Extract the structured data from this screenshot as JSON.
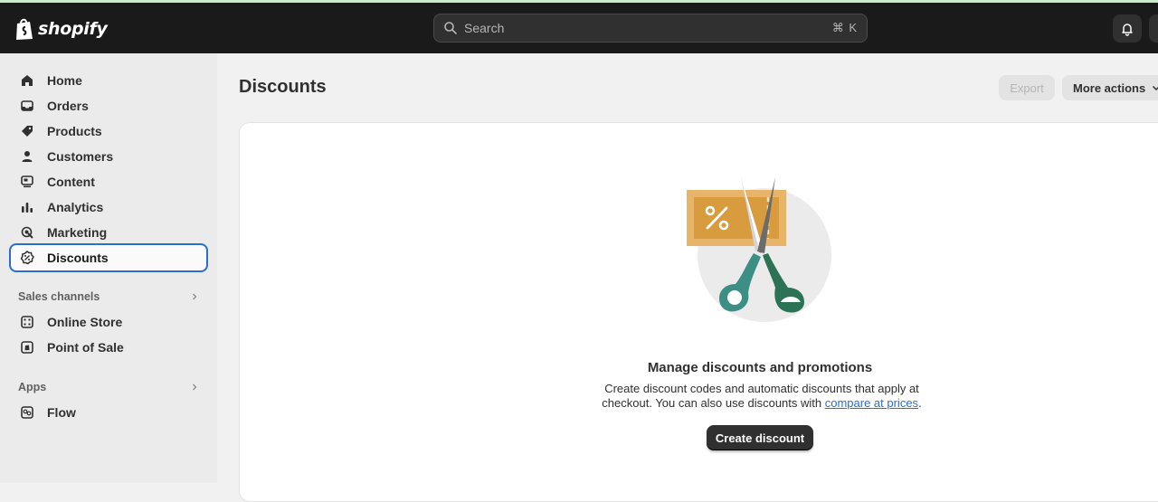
{
  "brand": {
    "name": "shopify"
  },
  "search": {
    "placeholder": "Search",
    "shortcut": "⌘ K"
  },
  "sidebar": {
    "items": [
      {
        "label": "Home",
        "icon": "home-icon"
      },
      {
        "label": "Orders",
        "icon": "inbox-icon"
      },
      {
        "label": "Products",
        "icon": "tag-icon"
      },
      {
        "label": "Customers",
        "icon": "person-icon"
      },
      {
        "label": "Content",
        "icon": "content-icon"
      },
      {
        "label": "Analytics",
        "icon": "bar-chart-icon"
      },
      {
        "label": "Marketing",
        "icon": "target-icon"
      },
      {
        "label": "Discounts",
        "icon": "discount-icon",
        "active": true
      }
    ],
    "sales_channels": {
      "title": "Sales channels",
      "items": [
        {
          "label": "Online Store",
          "icon": "store-icon"
        },
        {
          "label": "Point of Sale",
          "icon": "pos-icon"
        }
      ]
    },
    "apps": {
      "title": "Apps",
      "items": [
        {
          "label": "Flow",
          "icon": "flow-icon"
        }
      ]
    }
  },
  "main": {
    "title": "Discounts",
    "export_label": "Export",
    "more_actions_label": "More actions",
    "empty_state": {
      "heading": "Manage discounts and promotions",
      "body_prefix": "Create discount codes and automatic discounts that apply at checkout. You can also use discounts with ",
      "link_text": "compare at prices",
      "body_suffix": ".",
      "cta_label": "Create discount"
    }
  },
  "colors": {
    "topbar": "#1a1a1a",
    "active_outline": "#2c6ecb",
    "coupon": "#d89b3e",
    "scissor_handle_left": "#3d8f86",
    "scissor_handle_right": "#2c7356"
  }
}
